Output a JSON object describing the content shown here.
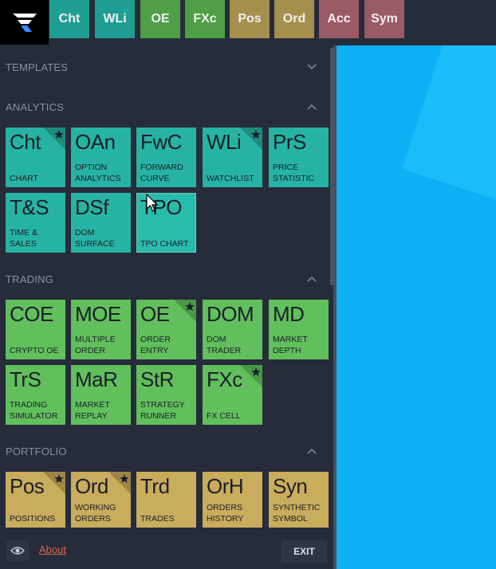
{
  "colors": {
    "analytics": "#27b3a3",
    "trading": "#61c05c",
    "portfolio": "#c9ac5c",
    "background": "#262c3a",
    "accent": "#0bb0f5"
  },
  "logo": {
    "icon": "brand-logo-icon"
  },
  "topbar": {
    "tabs": [
      {
        "label": "Cht",
        "color": "#1f9e93"
      },
      {
        "label": "WLi",
        "color": "#1f9e93"
      },
      {
        "label": "OE",
        "color": "#4e9f46"
      },
      {
        "label": "FXc",
        "color": "#4e9f46"
      },
      {
        "label": "Pos",
        "color": "#a58f4c"
      },
      {
        "label": "Ord",
        "color": "#a58f4c"
      },
      {
        "label": "Acc",
        "color": "#9a5a66"
      },
      {
        "label": "Sym",
        "color": "#9a5a66"
      }
    ]
  },
  "sections": {
    "templates": {
      "label": "TEMPLATES",
      "collapsed": true
    },
    "analytics": {
      "label": "ANALYTICS",
      "tiles": [
        {
          "abbr": "Cht",
          "name": "CHART",
          "fav": true
        },
        {
          "abbr": "OAn",
          "name": "OPTION ANALYTICS",
          "fav": false
        },
        {
          "abbr": "FwC",
          "name": "FORWARD CURVE",
          "fav": false
        },
        {
          "abbr": "WLi",
          "name": "WATCHLIST",
          "fav": true
        },
        {
          "abbr": "PrS",
          "name": "PRICE STATISTIC",
          "fav": false
        },
        {
          "abbr": "T&S",
          "name": "TIME & SALES",
          "fav": false
        },
        {
          "abbr": "DSf",
          "name": "DOM SURFACE",
          "fav": false
        },
        {
          "abbr": "TPO",
          "name": "TPO CHART",
          "fav": false,
          "hover": true
        }
      ]
    },
    "trading": {
      "label": "TRADING",
      "tiles": [
        {
          "abbr": "COE",
          "name": "CRYPTO OE",
          "fav": false
        },
        {
          "abbr": "MOE",
          "name": "MULTIPLE ORDER",
          "fav": false
        },
        {
          "abbr": "OE",
          "name": "ORDER ENTRY",
          "fav": true
        },
        {
          "abbr": "DOM",
          "name": "DOM TRADER",
          "fav": false
        },
        {
          "abbr": "MD",
          "name": "MARKET DEPTH",
          "fav": false
        },
        {
          "abbr": "TrS",
          "name": "TRADING SIMULATOR",
          "fav": false
        },
        {
          "abbr": "MaR",
          "name": "MARKET REPLAY",
          "fav": false
        },
        {
          "abbr": "StR",
          "name": "STRATEGY RUNNER",
          "fav": false
        },
        {
          "abbr": "FXc",
          "name": "FX CELL",
          "fav": true
        }
      ]
    },
    "portfolio": {
      "label": "PORTFOLIO",
      "tiles": [
        {
          "abbr": "Pos",
          "name": "POSITIONS",
          "fav": true
        },
        {
          "abbr": "Ord",
          "name": "WORKING ORDERS",
          "fav": true
        },
        {
          "abbr": "Trd",
          "name": "TRADES",
          "fav": false
        },
        {
          "abbr": "OrH",
          "name": "ORDERS HISTORY",
          "fav": false
        },
        {
          "abbr": "Syn",
          "name": "SYNTHETIC SYMBOL",
          "fav": false
        }
      ]
    }
  },
  "footer": {
    "about_label": "About",
    "exit_label": "EXIT",
    "eye_icon": "eye-icon"
  }
}
